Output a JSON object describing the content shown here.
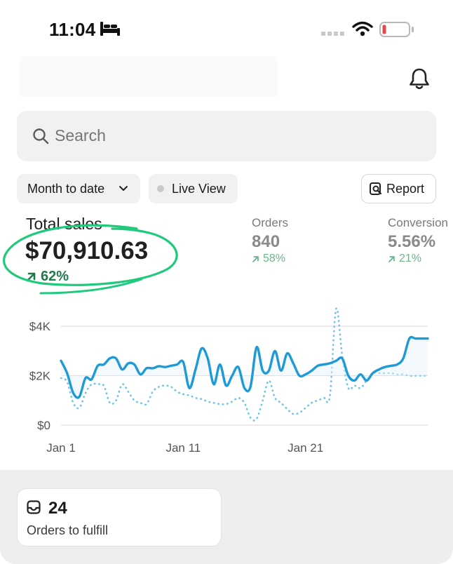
{
  "status_bar": {
    "time": "11:04",
    "icons": [
      "bed-icon",
      "cellular-signal-icon",
      "wifi-icon",
      "battery-low-icon"
    ],
    "battery_color": "#e5484d"
  },
  "header": {
    "icons": [
      "bell-icon"
    ]
  },
  "search": {
    "placeholder": "Search",
    "icon": "search-icon"
  },
  "filters": {
    "date_range": "Month to date",
    "live_view": "Live View",
    "report": "Report"
  },
  "metrics": {
    "total_sales": {
      "label": "Total sales",
      "value": "$70,910.63",
      "change": "62%",
      "direction": "up"
    },
    "orders": {
      "label": "Orders",
      "value": "840",
      "change": "58%",
      "direction": "up"
    },
    "conversion": {
      "label": "Conversion",
      "value": "5.56%",
      "change": "21%",
      "direction": "up"
    }
  },
  "chart_data": {
    "type": "line",
    "y_tick_labels": [
      "$4K",
      "$2K",
      "$0"
    ],
    "y_ticks": [
      4000,
      2000,
      0
    ],
    "ylim": [
      0,
      4000
    ],
    "x_tick_labels": [
      "Jan 1",
      "Jan 11",
      "Jan 21"
    ],
    "x_ticks": [
      1,
      11,
      21
    ],
    "xlim": [
      1,
      31
    ],
    "colors": {
      "current": "#1e9bd7",
      "previous": "#6fc3e8"
    },
    "series": [
      {
        "style": "solid",
        "x": [
          1,
          1.5,
          2,
          2.5,
          3,
          3.5,
          4,
          4.5,
          5,
          5.5,
          6,
          6.5,
          7,
          7.5,
          8,
          8.5,
          9,
          9.5,
          10,
          10.5,
          11,
          11.5,
          12,
          12.5,
          13,
          13.5,
          14,
          14.5,
          15,
          15.5,
          16,
          16.5,
          17,
          17.5,
          18,
          18.5,
          19,
          19.5,
          20,
          20.5,
          21,
          21.5,
          22,
          22.5,
          23,
          23.5,
          24,
          24.5,
          25,
          25.5,
          26,
          26.5,
          27,
          27.5,
          28,
          28.5,
          29,
          29.5,
          30,
          30.5,
          31
        ],
        "values": [
          2600,
          2100,
          1300,
          1150,
          1900,
          1850,
          2400,
          2450,
          2700,
          2700,
          2250,
          2500,
          2450,
          2050,
          2300,
          2300,
          2380,
          2350,
          2400,
          2450,
          2550,
          1500,
          2250,
          3100,
          2700,
          1650,
          2450,
          1600,
          2000,
          2350,
          1500,
          1550,
          3150,
          2200,
          2200,
          3000,
          2200,
          2900,
          2500,
          2000,
          2050,
          2200,
          2400,
          2450,
          2500,
          2600,
          2700,
          2000,
          1800,
          2050,
          1800,
          2100,
          2250,
          2350,
          2400,
          2450,
          2700,
          3500,
          3500,
          3500,
          3500
        ]
      },
      {
        "style": "dotted",
        "x": [
          1,
          1.5,
          2,
          2.5,
          3,
          3.5,
          4,
          4.5,
          5,
          5.5,
          6,
          6.5,
          7,
          7.5,
          8,
          8.5,
          9,
          9.5,
          10,
          10.5,
          11,
          11.5,
          12,
          12.5,
          13,
          13.5,
          14,
          14.5,
          15,
          15.5,
          16,
          16.5,
          17,
          17.5,
          18,
          18.5,
          19,
          19.5,
          20,
          20.5,
          21,
          21.5,
          22,
          22.5,
          23,
          23.5,
          24,
          24.5,
          25,
          25.5,
          26,
          26.5,
          27,
          27.5,
          28,
          28.5,
          29,
          29.5,
          30,
          30.5,
          31
        ],
        "values": [
          1900,
          1750,
          900,
          700,
          1300,
          1650,
          1650,
          1600,
          900,
          1000,
          1650,
          1350,
          1000,
          900,
          850,
          1350,
          1550,
          1600,
          1550,
          1350,
          1250,
          1200,
          1100,
          1050,
          950,
          900,
          850,
          850,
          950,
          1100,
          900,
          300,
          250,
          1000,
          1800,
          1100,
          900,
          650,
          450,
          500,
          700,
          900,
          1000,
          1100,
          1200,
          4700,
          2800,
          1500,
          1600,
          1500,
          1800,
          2100,
          2100,
          2100,
          2100,
          2050,
          2050,
          2000,
          2000,
          2000,
          2000
        ]
      }
    ]
  },
  "tasks": {
    "orders_to_fulfill": {
      "count": "24",
      "label": "Orders to fulfill",
      "icon": "inbox-tray-icon"
    }
  }
}
